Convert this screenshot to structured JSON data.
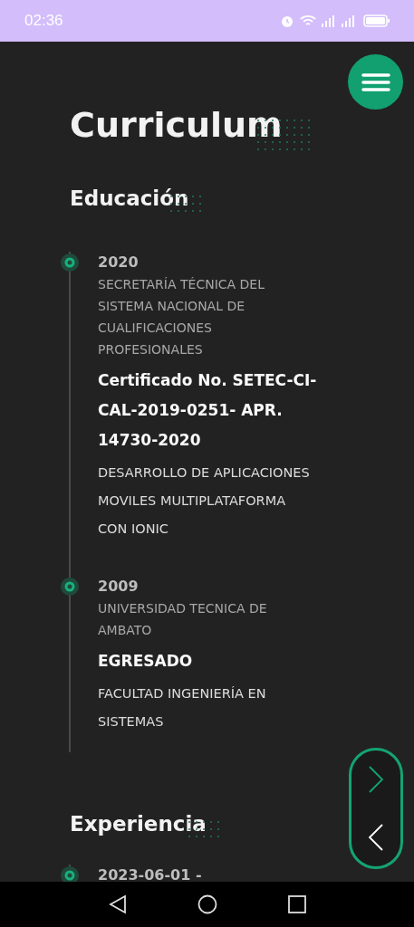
{
  "status_bar": {
    "time": "02:36"
  },
  "title": "Curriculum",
  "sections": [
    {
      "heading": "Educación",
      "entries": [
        {
          "year": "2020",
          "institution": "SECRETARÍA TÉCNICA DEL SISTEMA NACIONAL DE CUALIFICACIONES PROFESIONALES",
          "title": "Certificado No. SETEC-CI-CAL-2019-0251- APR. 14730-2020",
          "description": "DESARROLLO DE APLICACIONES MOVILES MULTIPLATAFORMA CON IONIC"
        },
        {
          "year": "2009",
          "institution": "UNIVERSIDAD TECNICA DE AMBATO",
          "title": "EGRESADO",
          "description": "FACULTAD INGENIERÍA EN SISTEMAS"
        }
      ]
    },
    {
      "heading": "Experiencia",
      "entries": [
        {
          "year": "2023-06-01 -"
        }
      ]
    }
  ]
}
